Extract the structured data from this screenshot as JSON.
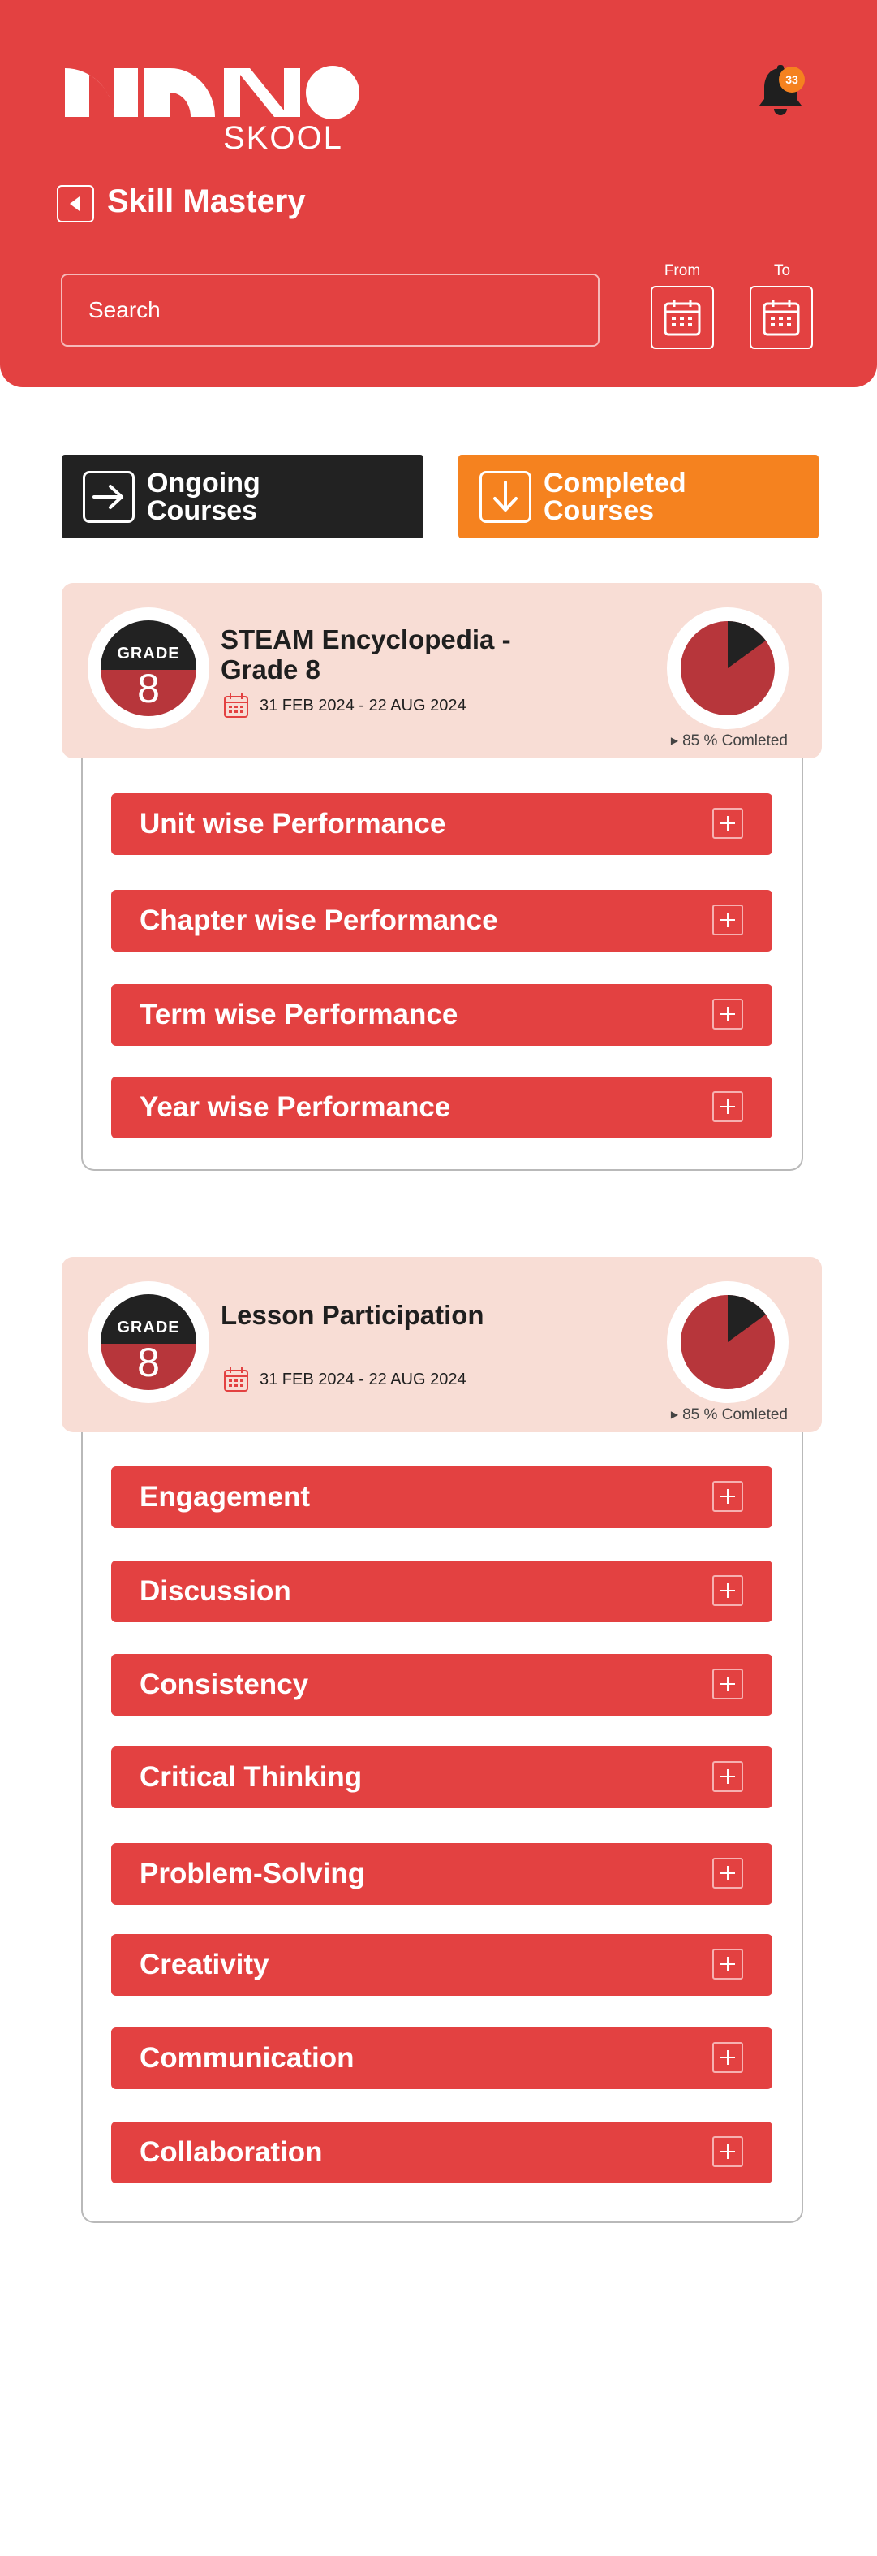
{
  "brand": {
    "logo_word": "NANO",
    "logo_sub": "SKOOL"
  },
  "notifications": {
    "count": "33"
  },
  "header": {
    "title": "Skill Mastery"
  },
  "search": {
    "placeholder": "Search"
  },
  "date_filter": {
    "from_label": "From",
    "to_label": "To"
  },
  "tabs": [
    {
      "label_line1": "Ongoing",
      "label_line2": "Courses",
      "icon": "arrow-right-icon",
      "active": true
    },
    {
      "label_line1": "Completed",
      "label_line2": "Courses",
      "icon": "arrow-down-icon",
      "active": false
    }
  ],
  "cards": [
    {
      "grade_label": "GRADE",
      "grade_value": "8",
      "title_line1": "STEAM Encyclopedia -",
      "title_line2": "Grade 8",
      "date_range": "31 FEB 2024 - 22 AUG 2024",
      "completion_text": "85 % Comleted",
      "completion_fraction": 0.85,
      "sections": [
        "Unit wise Performance",
        "Chapter wise Performance",
        "Term wise Performance",
        "Year wise Performance"
      ]
    },
    {
      "grade_label": "GRADE",
      "grade_value": "8",
      "title_line1": "Lesson Participation",
      "title_line2": "",
      "date_range": "31 FEB 2024 - 22 AUG 2024",
      "completion_text": "85 % Comleted",
      "completion_fraction": 0.85,
      "sections": [
        "Engagement",
        "Discussion",
        "Consistency",
        "Critical Thinking",
        "Problem-Solving",
        "Creativity",
        "Communication",
        "Collaboration"
      ]
    }
  ],
  "colors": {
    "brand_red": "#e34141",
    "dark": "#222222",
    "orange": "#f5821f",
    "card_bg": "#f8ddd5",
    "pie_fill": "#b7363b"
  }
}
